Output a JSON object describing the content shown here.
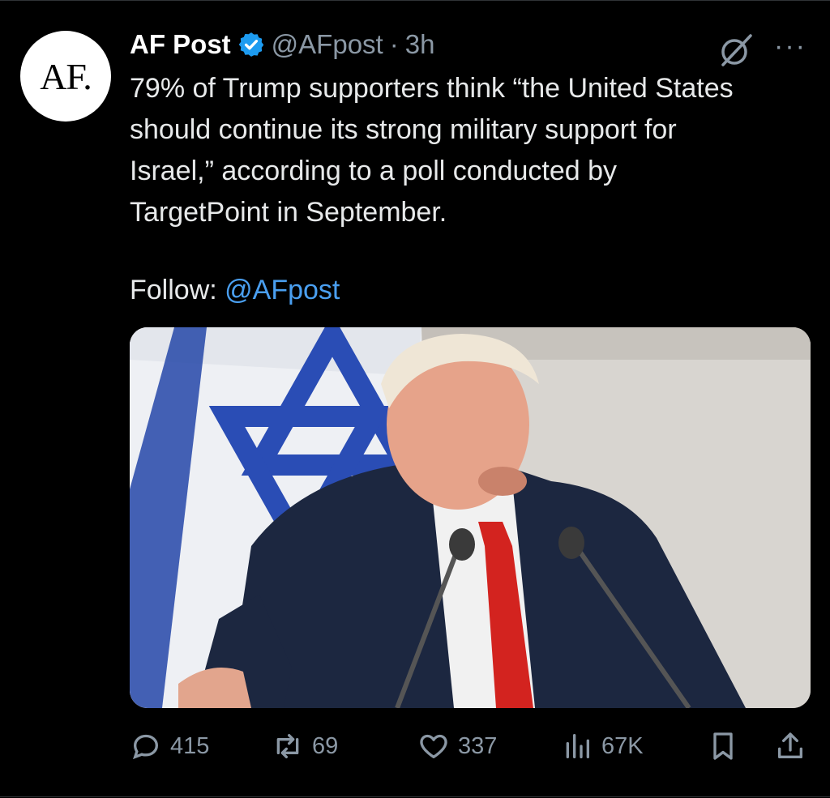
{
  "account": {
    "avatar_text": "AF.",
    "display_name": "AF Post",
    "handle": "@AFpost",
    "separator": "·",
    "time": "3h"
  },
  "tweet": {
    "text": "79% of Trump supporters think “the United States should continue its strong military support for Israel,” according to a poll conducted by TargetPoint in September.",
    "follow_label": "Follow:",
    "follow_mention": "@AFpost"
  },
  "header_icons": {
    "grok": "grok-icon",
    "more": "more-icon"
  },
  "actions": {
    "replies": "415",
    "reposts": "69",
    "likes": "337",
    "views": "67K"
  },
  "colors": {
    "background": "#000000",
    "text": "#e7e9ea",
    "secondary": "#8b98a5",
    "link": "#4a9ff0",
    "verified": "#1d9bf0"
  }
}
